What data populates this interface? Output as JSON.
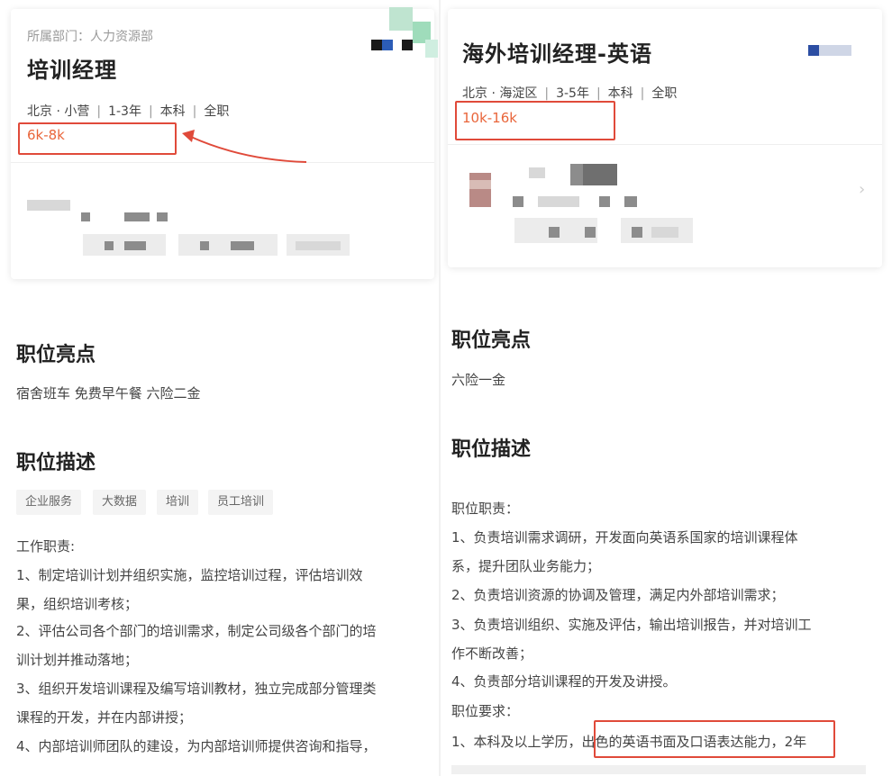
{
  "left": {
    "department": "所属部门：人力资源部",
    "title": "培训经理",
    "meta": [
      "北京 · 小营",
      "1-3年",
      "本科",
      "全职"
    ],
    "salary": "6k-8k",
    "highlights_heading": "职位亮点",
    "highlights_text": "宿舍班车 免费早午餐 六险二金",
    "description_heading": "职位描述",
    "tags": [
      "企业服务",
      "大数据",
      "培训",
      "员工培训"
    ],
    "duties_label": "工作职责:",
    "lines": [
      "1、制定培训计划并组织实施，监控培训过程，评估培训效",
      "果，组织培训考核；",
      "2、评估公司各个部门的培训需求，制定公司级各个部门的培",
      "训计划并推动落地；",
      "3、组织开发培训课程及编写培训教材，独立完成部分管理类",
      "课程的开发，并在内部讲授；",
      "4、内部培训师团队的建设，为内部培训师提供咨询和指导，"
    ]
  },
  "right": {
    "title": "海外培训经理-英语",
    "meta": [
      "北京 · 海淀区",
      "3-5年",
      "本科",
      "全职"
    ],
    "salary": "10k-16k",
    "highlights_heading": "职位亮点",
    "highlights_text": "六险一金",
    "description_heading": "职位描述",
    "duties_label": "职位职责：",
    "lines": [
      "1、负责培训需求调研，开发面向英语系国家的培训课程体",
      "系，提升团队业务能力；",
      "2、负责培训资源的协调及管理，满足内外部培训需求；",
      "3、负责培训组织、实施及评估，输出培训报告，并对培训工",
      "作不断改善；",
      "4、负责部分培训课程的开发及讲授。"
    ],
    "requirements_label": "职位要求：",
    "req_line_pre": "1、本科及以上学历，",
    "req_line_highlight": "出色的英语书面及口语表达能力，",
    "req_line_post": "2年"
  },
  "colors": {
    "salary": "#e9653a",
    "highlight_box": "#e04a3a",
    "arrow": "#e04a3a"
  }
}
